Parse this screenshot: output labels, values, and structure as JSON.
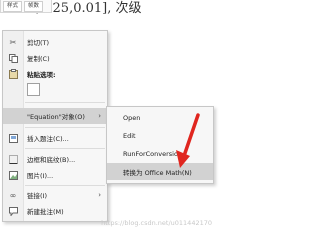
{
  "document": {
    "text": ",0.25,0.01], 次级"
  },
  "mini_toolbar": {
    "buttons": [
      "样式",
      "帧数"
    ]
  },
  "context_menu": {
    "items": [
      {
        "label": "剪切(T)",
        "icon": "scissors-icon"
      },
      {
        "label": "复制(C)",
        "icon": "copy-icon"
      },
      {
        "label": "粘贴选项:",
        "icon": "paste-icon"
      },
      {
        "label": "\"Equation\"对象(O)",
        "icon": "none",
        "has_submenu": true
      },
      {
        "label": "插入题注(C)...",
        "icon": "caption-icon"
      },
      {
        "label": "边框和底纹(B)...",
        "icon": "borders-icon"
      },
      {
        "label": "图片(I)...",
        "icon": "picture-icon"
      },
      {
        "label": "链接(I)",
        "icon": "link-icon",
        "has_submenu": true
      },
      {
        "label": "新建批注(M)",
        "icon": "comment-icon"
      }
    ]
  },
  "submenu": {
    "items": [
      {
        "label": "Open"
      },
      {
        "label": "Edit"
      },
      {
        "label": "RunForConversion"
      },
      {
        "label": "转换为 Office Math(N)"
      }
    ]
  },
  "watermark": "https://blog.csdn.net/u011442170",
  "colors": {
    "highlight": "#d2d2d2",
    "red_arrow": "#e0261f"
  }
}
